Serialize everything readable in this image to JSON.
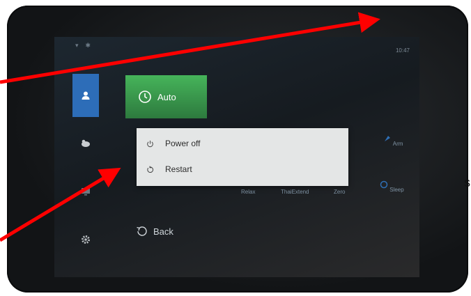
{
  "status_bar": {
    "icons": [
      "wifi-icon",
      "bluetooth-icon"
    ],
    "time": "10:47"
  },
  "sidebar": {
    "items": [
      {
        "icon": "user-icon",
        "active": true
      },
      {
        "icon": "massage-icon",
        "active": false
      },
      {
        "icon": "monitor-icon",
        "active": false
      },
      {
        "icon": "gear-icon",
        "active": false
      }
    ]
  },
  "main": {
    "auto_label": "Auto",
    "modes": [
      {
        "label": "Relax"
      },
      {
        "label": "ThaiExtend"
      },
      {
        "label": "Zero"
      },
      {
        "label": "Sleep"
      }
    ],
    "arm_label": "Arm",
    "back_label": "Back"
  },
  "power_dialog": {
    "items": [
      {
        "label": "Power off",
        "icon": "power-icon"
      },
      {
        "label": "Restart",
        "icon": "restart-icon"
      }
    ]
  },
  "annotation": {
    "text": "s",
    "arrow_color": "#ff0000"
  }
}
